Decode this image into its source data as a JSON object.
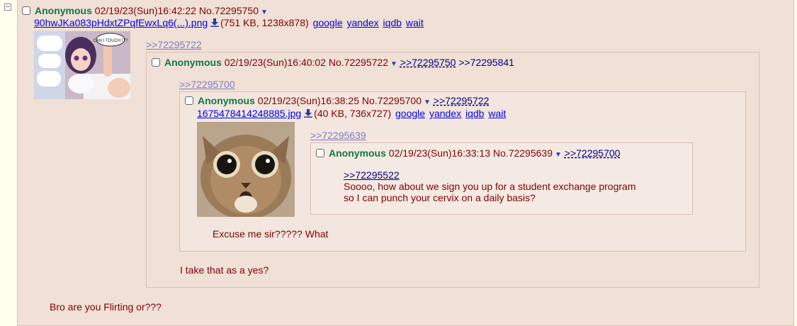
{
  "toggle_label": "−",
  "post_main": {
    "name": "Anonymous",
    "datetime": "02/19/23(Sun)16:42:22",
    "number": "No.72295750",
    "file_name": "90hwJKa083pHdxtZPqfEwxLq6(...).png",
    "file_info": "(751 KB, 1238x878)",
    "reply_header": ">>72295722",
    "message": "Bro are you Flirting or???",
    "thumbnail_text": "CAN I TOUCH IT?"
  },
  "post_quoted_1": {
    "name": "Anonymous",
    "datetime": "02/19/23(Sun)16:40:02",
    "number": "No.72295722",
    "backlinks": [
      ">>72295750",
      ">>72295841"
    ],
    "reply_header": ">>72295700",
    "message": "I take that as a yes?"
  },
  "post_quoted_2": {
    "name": "Anonymous",
    "datetime": "02/19/23(Sun)16:38:25",
    "number": "No.72295700",
    "backlinks": [
      ">>72295722"
    ],
    "file_name": "1675478414248885.jpg",
    "file_info": "(40 KB, 736x727)",
    "reply_header": ">>72295639",
    "message": "Excuse me sir????? What"
  },
  "post_quoted_3": {
    "name": "Anonymous",
    "datetime": "02/19/23(Sun)16:33:13",
    "number": "No.72295639",
    "backlinks": [
      ">>72295700"
    ],
    "quote": ">>72295522",
    "message_line1": "Soooo, how about we sign you up for a student exchange program",
    "message_line2": "so I can punch your cervix on a daily basis?"
  },
  "services": [
    "google",
    "yandex",
    "iqdb",
    "wait"
  ],
  "icons": {
    "caret": "chevron-down-icon",
    "download": "download-icon",
    "toggle": "minus-square-icon"
  },
  "colors": {
    "name": "#117743",
    "text": "#800000",
    "link": "#0000ee",
    "quotelink": "#000080",
    "post_bg": "#f0e0d6",
    "page_bg": "#ffffee"
  }
}
